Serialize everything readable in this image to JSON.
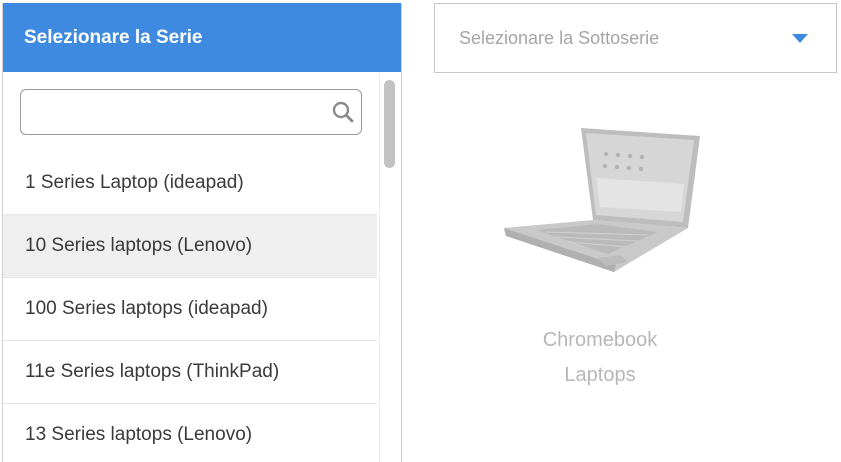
{
  "series_panel": {
    "title": "Selezionare la Serie",
    "search": {
      "value": "",
      "placeholder": ""
    },
    "items": [
      {
        "label": "1 Series Laptop (ideapad)"
      },
      {
        "label": "10 Series laptops (Lenovo)"
      },
      {
        "label": "100 Series laptops (ideapad)"
      },
      {
        "label": "11e Series laptops (ThinkPad)"
      },
      {
        "label": "13 Series laptops (Lenovo)"
      }
    ]
  },
  "subseries": {
    "placeholder": "Selezionare la Sottoserie"
  },
  "product": {
    "line1": "Chromebook",
    "line2": "Laptops"
  },
  "colors": {
    "accent": "#3d8ae0",
    "hover_row": "#efefef",
    "muted_text": "#a5a5a5"
  },
  "icons": {
    "search": "search-icon",
    "dropdown": "chevron-down-icon"
  }
}
